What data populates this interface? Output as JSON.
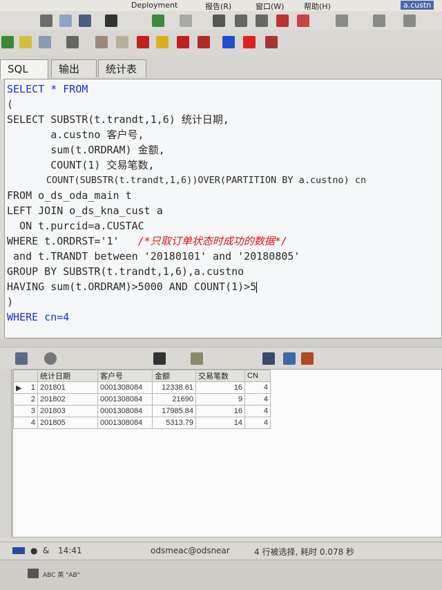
{
  "menubar": {
    "items": [
      "Deployment",
      "报告(R)",
      "窗口(W)",
      "帮助(H)"
    ],
    "window_title_fragment": "a.custn"
  },
  "tabs": [
    {
      "label": "SQL",
      "active": true
    },
    {
      "label": "输出",
      "active": false
    },
    {
      "label": "统计表",
      "active": false
    }
  ],
  "editor": {
    "l01": "SELECT * FROM",
    "l02": "(",
    "l03": "SELECT SUBSTR(t.trandt,1,6) 统计日期,",
    "l04": "       a.custno 客户号,",
    "l05": "       sum(t.ORDRAM) 金额,",
    "l06": "       COUNT(1) 交易笔数,",
    "l07": "       COUNT(SUBSTR(t.trandt,1,6))OVER(PARTITION BY a.custno) cn",
    "l08": "FROM o_ds_oda_main t",
    "l09": "LEFT JOIN o_ds_kna_cust a",
    "l10": "  ON t.purcid=a.CUSTAC",
    "l11a": "WHERE t.ORDRST='1'   ",
    "l11b": "/*只取订单状态时成功的数据*/",
    "l12": " and t.TRANDT between '20180101' and '20180805'",
    "l13": "GROUP BY SUBSTR(t.trandt,1,6),a.custno",
    "l14": "HAVING sum(t.ORDRAM)>5000 AND COUNT(1)>5",
    "l15": ")",
    "l16": "WHERE cn=4"
  },
  "grid": {
    "headers": [
      "",
      "统计日期",
      "客户号",
      "金额",
      "交易笔数",
      "CN"
    ],
    "rows": [
      [
        "1",
        "201801",
        "0001308084",
        "12338.61",
        "16",
        "4"
      ],
      [
        "2",
        "201802",
        "0001308084",
        "21690",
        "9",
        "4"
      ],
      [
        "3",
        "201803",
        "0001308084",
        "17985.84",
        "16",
        "4"
      ],
      [
        "4",
        "201805",
        "0001308084",
        "5313.79",
        "14",
        "4"
      ]
    ]
  },
  "status": {
    "time": "14:41",
    "connection": "odsmeac@odsnear",
    "message": "4 行被选择, 耗时 0.078 秒"
  },
  "bottom": {
    "ime": "ABC 英 \"AB\""
  }
}
